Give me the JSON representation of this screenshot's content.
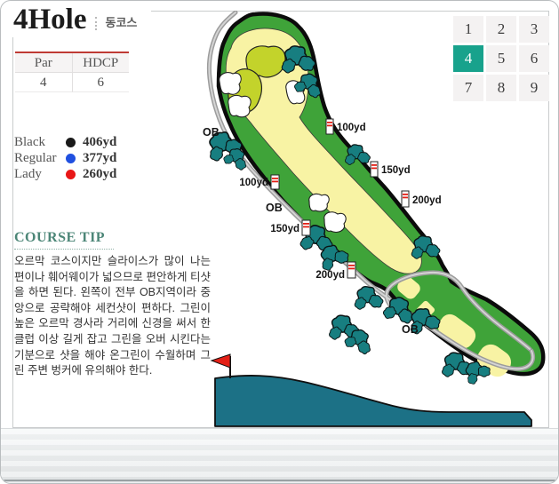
{
  "header": {
    "title": "4Hole",
    "subtitle": "동코스"
  },
  "par_table": {
    "headers": [
      "Par",
      "HDCP"
    ],
    "values": [
      "4",
      "6"
    ]
  },
  "tees": [
    {
      "name": "Black",
      "color": "#1a1a1a",
      "distance": "406yd"
    },
    {
      "name": "Regular",
      "color": "#2050e0",
      "distance": "377yd"
    },
    {
      "name": "Lady",
      "color": "#e81717",
      "distance": "260yd"
    }
  ],
  "course_tip": {
    "heading": "COURSE TIP",
    "body": "오르막 코스이지만 슬라이스가 많이 나는 편이나 훼어웨이가 넓으므로 편안하게 티샷을 하면 된다. 왼쪽이 전부 OB지역이라 중앙으로 공략해야 세컨샷이 편하다. 그린이 높은 오르막 경사라 거리에 신경을 써서 한 클럽 이상 길게 잡고 그린을 오버 시킨다는 기분으로 샷을 해야 온그린이 수월하며 그린 주변 벙커에 유의해야 한다."
  },
  "hole_grid": {
    "cells": [
      "1",
      "2",
      "3",
      "4",
      "5",
      "6",
      "7",
      "8",
      "9"
    ],
    "active": "4",
    "active_color": "#18a28c"
  },
  "map": {
    "ob_labels": [
      "OB",
      "OB",
      "OB"
    ],
    "left_markers": [
      {
        "label": "100yd"
      },
      {
        "label": "150yd"
      },
      {
        "label": "200yd"
      }
    ],
    "right_markers": [
      {
        "label": "100yd"
      },
      {
        "label": "150yd"
      },
      {
        "label": "200yd"
      }
    ],
    "colors": {
      "fairway": "#f8f3a4",
      "rough_band": "#3fa339",
      "putting_green": "#c3d32b",
      "trees": "#177e80",
      "cart_path": "#b3b3b3",
      "elevation_profile": "#1c7186",
      "flag": "#e32017",
      "table_accent_red": "#bf3a34",
      "tip_heading_teal": "#4c8677"
    }
  }
}
